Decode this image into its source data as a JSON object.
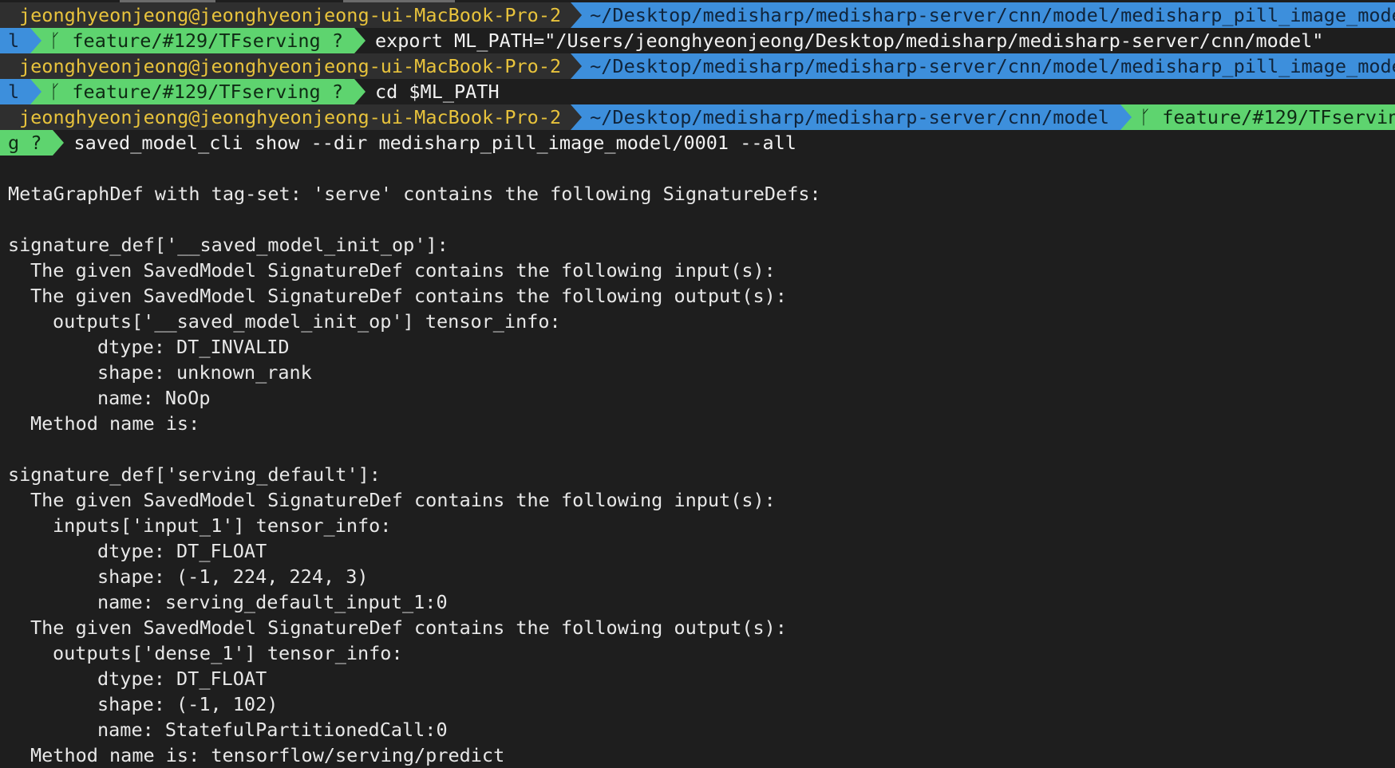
{
  "prompt": {
    "user": "jeonghyeonjeong@jeonghyeonjeong-ui-MacBook-Pro-2",
    "path_long": "~/Desktop/medisharp/medisharp-server/cnn/model/medisharp_pill_image_mode",
    "path_long_wrap": "l",
    "path_short": "~/Desktop/medisharp/medisharp-server/cnn/model",
    "branch": "ᚴ feature/#129/TFserving ?",
    "branch_wrap_head": "ᚴ feature/#129/TFservin",
    "branch_wrap_tail": "g ?"
  },
  "commands": [
    "export ML_PATH=\"/Users/jeonghyeonjeong/Desktop/medisharp/medisharp-server/cnn/model\"",
    "cd $ML_PATH",
    "saved_model_cli show --dir medisharp_pill_image_model/0001 --all"
  ],
  "output": {
    "header": "MetaGraphDef with tag-set: 'serve' contains the following SignatureDefs:",
    "sig1": {
      "title": "signature_def['__saved_model_init_op']:",
      "inputs_line": "The given SavedModel SignatureDef contains the following input(s):",
      "outputs_line": "The given SavedModel SignatureDef contains the following output(s):",
      "tensor": "outputs['__saved_model_init_op'] tensor_info:",
      "dtype": "dtype: DT_INVALID",
      "shape": "shape: unknown_rank",
      "name": "name: NoOp",
      "method": "Method name is:"
    },
    "sig2": {
      "title": "signature_def['serving_default']:",
      "inputs_line": "The given SavedModel SignatureDef contains the following input(s):",
      "in_tensor": "inputs['input_1'] tensor_info:",
      "in_dtype": "dtype: DT_FLOAT",
      "in_shape": "shape: (-1, 224, 224, 3)",
      "in_name": "name: serving_default_input_1:0",
      "outputs_line": "The given SavedModel SignatureDef contains the following output(s):",
      "out_tensor": "outputs['dense_1'] tensor_info:",
      "out_dtype": "dtype: DT_FLOAT",
      "out_shape": "shape: (-1, 102)",
      "out_name": "name: StatefulPartitionedCall:0",
      "method": "Method name is: tensorflow/serving/predict"
    }
  },
  "colors": {
    "background": "#1e1e1e",
    "user_segment": "#2f2f2f",
    "user_text": "#e8c33c",
    "path_segment": "#3d8fdc",
    "git_segment": "#5ed46f",
    "text": "#e8e8e8"
  }
}
